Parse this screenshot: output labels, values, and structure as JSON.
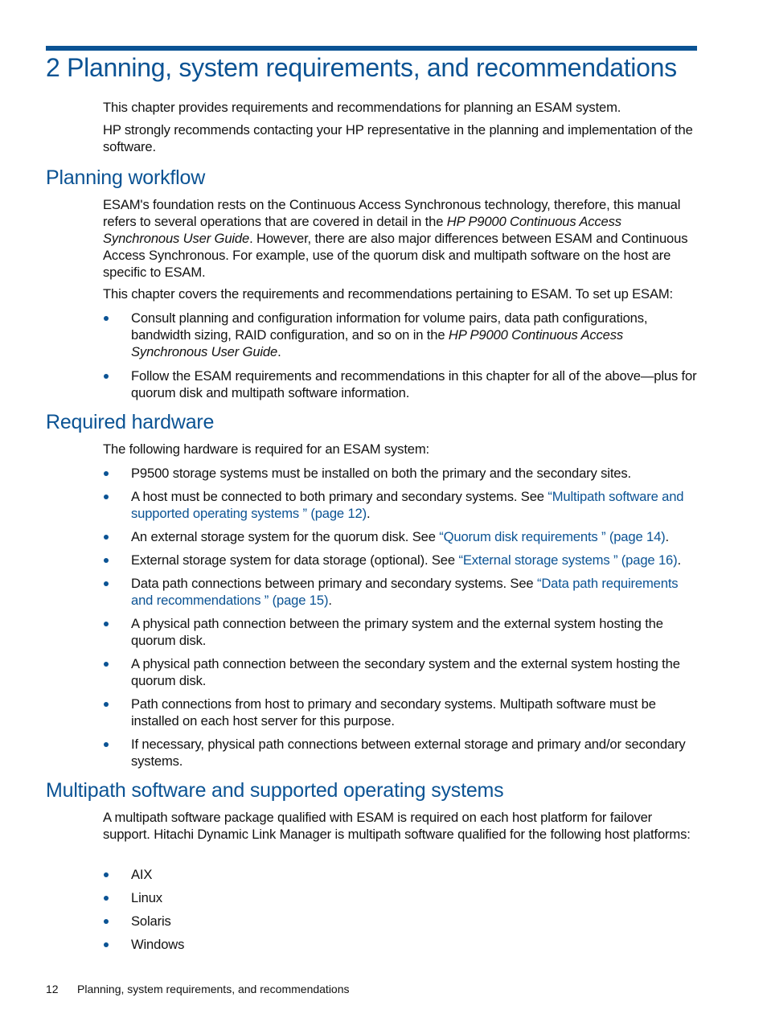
{
  "colors": {
    "accent": "#0b5394",
    "text": "#111111"
  },
  "chapter": {
    "title": "2 Planning, system requirements, and recommendations",
    "intro": [
      "This chapter provides requirements and recommendations for planning an ESAM system.",
      "HP strongly recommends contacting your HP representative in the planning and implementation of the software."
    ]
  },
  "planning_workflow": {
    "heading": "Planning workflow",
    "para1": {
      "t1": "ESAM's foundation rests on the Continuous Access Synchronous technology, therefore, this manual refers to several operations that are covered in detail in the ",
      "italic": "HP P9000 Continuous Access Synchronous User Guide",
      "t2": ". However, there are also major differences between ESAM and Continuous Access Synchronous. For example, use of the quorum disk and multipath software on the host are specific to ESAM."
    },
    "para2": "This chapter covers the requirements and recommendations pertaining to ESAM. To set up ESAM:",
    "bullets": [
      {
        "t1": "Consult planning and configuration information for volume pairs, data path configurations, bandwidth sizing, RAID configuration, and so on in the ",
        "italic": "HP P9000 Continuous Access Synchronous User Guide",
        "t2": "."
      },
      {
        "t1": "Follow the ESAM requirements and recommendations in this chapter for all of the above—plus for quorum disk and multipath software information."
      }
    ]
  },
  "required_hardware": {
    "heading": "Required hardware",
    "intro": "The following hardware is required for an ESAM system:",
    "bullets": [
      {
        "text": "P9500 storage systems must be installed on both the primary and the secondary sites."
      },
      {
        "text": "A host must be connected to both primary and secondary systems. See ",
        "link": "“Multipath software and supported operating systems ” (page 12)",
        "after": "."
      },
      {
        "text": "An external storage system for the quorum disk. See ",
        "link": "“Quorum disk requirements ” (page 14)",
        "after": "."
      },
      {
        "text": "External storage system for data storage (optional). See ",
        "link": "“External storage systems ” (page 16)",
        "after": "."
      },
      {
        "text": "Data path connections between primary and secondary systems. See ",
        "link": "“Data path requirements and recommendations ” (page 15)",
        "after": "."
      },
      {
        "text": "A physical path connection between the primary system and the external system hosting the quorum disk."
      },
      {
        "text": "A physical path connection between the secondary system and the external system hosting the quorum disk."
      },
      {
        "text": "Path connections from host to primary and secondary systems. Multipath software must be installed on each host server for this purpose."
      },
      {
        "text": "If necessary, physical path connections between external storage and primary and/or secondary systems."
      }
    ]
  },
  "multipath": {
    "heading": "Multipath software and supported operating systems",
    "intro": "A multipath software package qualified with ESAM is required on each host platform for failover support. Hitachi Dynamic Link Manager is multipath software qualified for the following host platforms:",
    "platforms": [
      "AIX",
      "Linux",
      "Solaris",
      "Windows"
    ]
  },
  "footer": {
    "page_number": "12",
    "running_title": "Planning, system requirements, and recommendations"
  }
}
